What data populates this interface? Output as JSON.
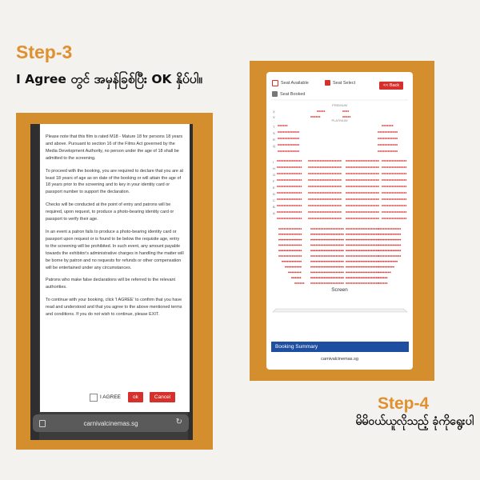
{
  "step3": {
    "label": "Step-3",
    "caption": "I Agree တွင် အမှန်ခြစ်ပြီး OK နှိပ်ပါ။"
  },
  "step4": {
    "label": "Step-4",
    "caption": "မိမိဝယ်ယူလိုသည့် ခုံကိုရွေးပါ"
  },
  "dialog": {
    "paragraphs": [
      "Please note that this film is rated M18 - Mature 18 for persons 18 years and above. Pursuant to section 16 of the Films Act governed by the Media Development Authority, no person under the age of 18 shall be admitted to the screening.",
      "To proceed with the booking, you are required to declare that you are at least 18 years of age as on date of the booking or will attain the age of 18 years prior to the screening and to key in your identity card or passport number to support the declaration.",
      "Checks will be conducted at the point of entry and patrons will be required, upon request, to produce a photo-bearing identity card or passport to verify their age.",
      "In an event a patron fails to produce a photo-bearing identity card or passport upon request or is found to be below the requisite age, entry to the screening will be prohibited. In such event, any amount payable towards the exhibitor's administrative charges in handling the matter will be borne by patron and no requests for refunds or other compensation will be entertained under any circumstances.",
      "Patrons who make false declarations will be referred to the relevant authorities.",
      "To continue with your booking, click 'I AGREE' to confirm that you have read and understood and that you agree to the above mentioned terms and conditions. If you do not wish to continue, please EXIT."
    ],
    "agree_label": "I AGREE",
    "ok_label": "ok",
    "cancel_label": "Cancel"
  },
  "browser": {
    "url": "carnivalcinemas.sg"
  },
  "seat_screen": {
    "legend": {
      "available": "Seat Available",
      "select": "Seat Select",
      "booked": "Seat Booked"
    },
    "back_label": "<< Back",
    "premium_label": "PREMIUM",
    "platinum_label": "PLATINUM",
    "row_letters_top": [
      "X",
      "V"
    ],
    "row_letters_platinum": [
      "T",
      "S",
      "R",
      "Q"
    ],
    "row_letters_middle": [
      "I",
      "H",
      "G",
      "F",
      "E",
      "D",
      "C",
      "B",
      "A"
    ],
    "screen_label": "Screen",
    "summary_label": "Booking Summary",
    "site": "carnivalcinemas.sg"
  },
  "colors": {
    "accent_orange": "#e0902e",
    "frame_orange": "#d58e2e",
    "seat_red": "#d6302c",
    "summary_blue": "#1d4ea0",
    "booked_gray": "#777777"
  }
}
